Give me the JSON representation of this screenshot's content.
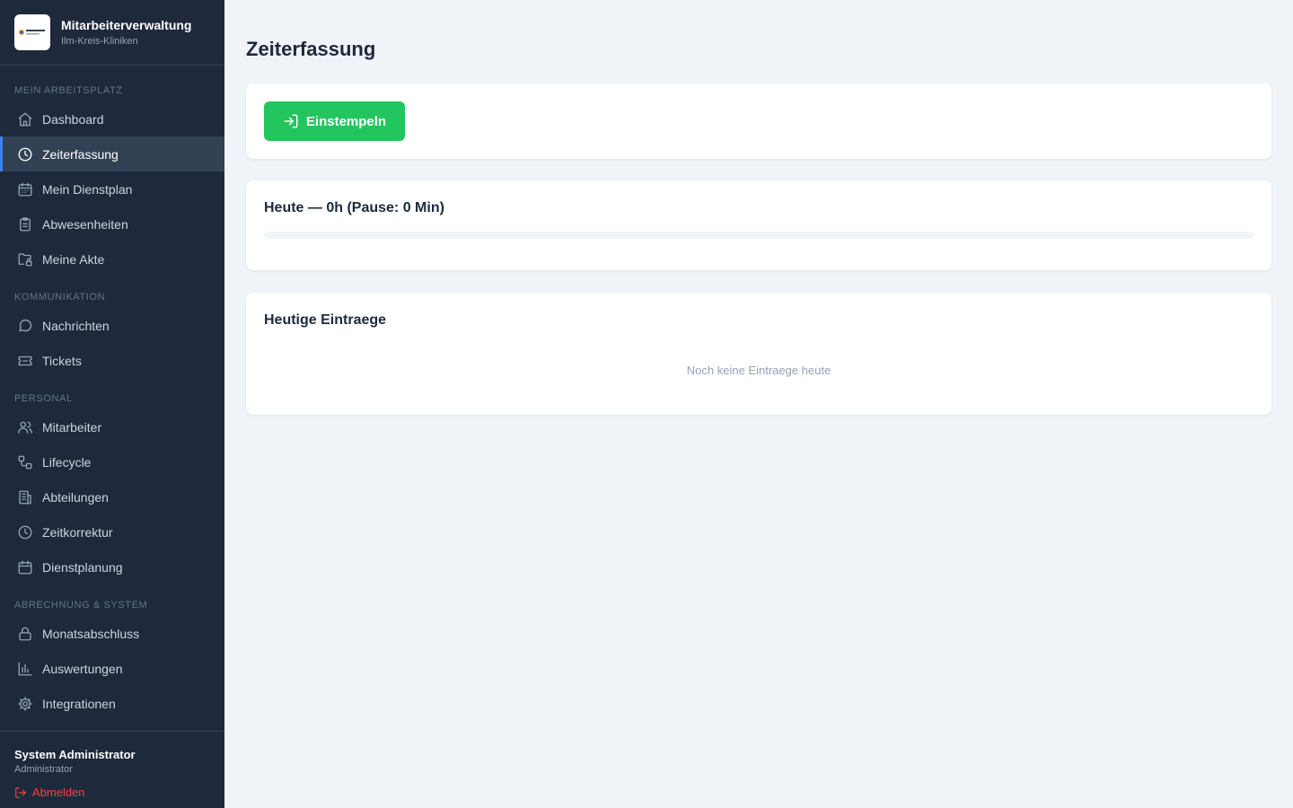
{
  "app": {
    "title": "Mitarbeiterverwaltung",
    "subtitle": "Ilm-Kreis-Kliniken",
    "logo_text": "Ilm-Kreis-Kliniken"
  },
  "nav": {
    "sections": [
      {
        "title": "MEIN ARBEITSPLATZ",
        "items": [
          {
            "label": "Dashboard",
            "icon": "home-icon"
          },
          {
            "label": "Zeiterfassung",
            "icon": "clock-icon",
            "active": true
          },
          {
            "label": "Mein Dienstplan",
            "icon": "calendar-icon"
          },
          {
            "label": "Abwesenheiten",
            "icon": "clipboard-icon"
          },
          {
            "label": "Meine Akte",
            "icon": "folder-lock-icon"
          }
        ]
      },
      {
        "title": "KOMMUNIKATION",
        "items": [
          {
            "label": "Nachrichten",
            "icon": "message-icon"
          },
          {
            "label": "Tickets",
            "icon": "ticket-icon"
          }
        ]
      },
      {
        "title": "PERSONAL",
        "items": [
          {
            "label": "Mitarbeiter",
            "icon": "users-icon"
          },
          {
            "label": "Lifecycle",
            "icon": "workflow-icon"
          },
          {
            "label": "Abteilungen",
            "icon": "building-icon"
          },
          {
            "label": "Zeitkorrektur",
            "icon": "clock-icon"
          },
          {
            "label": "Dienstplanung",
            "icon": "calendar-icon"
          }
        ]
      },
      {
        "title": "ABRECHNUNG & SYSTEM",
        "items": [
          {
            "label": "Monatsabschluss",
            "icon": "lock-icon"
          },
          {
            "label": "Auswertungen",
            "icon": "bar-chart-icon"
          },
          {
            "label": "Integrationen",
            "icon": "gear-icon"
          }
        ]
      }
    ]
  },
  "user": {
    "name": "System Administrator",
    "role": "Administrator",
    "logout_label": "Abmelden"
  },
  "page": {
    "title": "Zeiterfassung",
    "clock_in_label": "Einstempeln",
    "today_title": "Heute — 0h (Pause: 0 Min)",
    "today_progress": 0,
    "entries_title": "Heutige Eintraege",
    "entries_empty": "Noch keine Eintraege heute"
  },
  "colors": {
    "sidebar_bg": "#1e293b",
    "accent": "#3b82f6",
    "success": "#22c55e",
    "danger": "#ef4444",
    "page_bg": "#f0f4f9"
  }
}
